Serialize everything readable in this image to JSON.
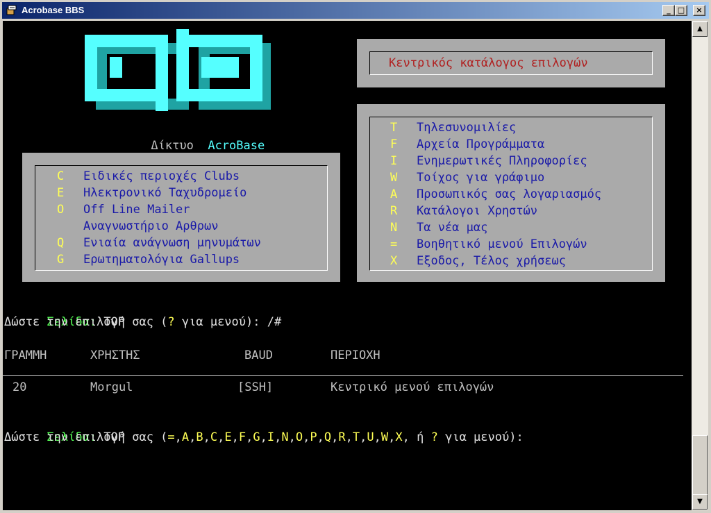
{
  "window": {
    "title": "Acrobase BBS",
    "buttons": {
      "minimize": "_",
      "maximize": "□",
      "close": "×"
    }
  },
  "logo": {
    "network_label": "Δίκτυο",
    "network_name": "AcroBase",
    "color": "#55ffff"
  },
  "main_menu_title": "Κεντρικός κατάλογος επιλογών",
  "left_menu": [
    {
      "key": "C",
      "label": "Ειδικές περιοχές Clubs"
    },
    {
      "key": "E",
      "label": "Ηλεκτρονικό Ταχυδρομείο"
    },
    {
      "key": "O",
      "label": "Off Line Mailer"
    },
    {
      "key": "",
      "label": "Αναγνωστήριο Αρθρων"
    },
    {
      "key": "Q",
      "label": "Ενιαία ανάγνωση μηνυμάτων"
    },
    {
      "key": "G",
      "label": "Ερωτηματολόγια Gallups"
    }
  ],
  "right_menu": [
    {
      "key": "T",
      "label": "Τηλεσυνομιλίες"
    },
    {
      "key": "F",
      "label": "Αρχεία Προγράμματα"
    },
    {
      "key": "I",
      "label": "Ενημερωτικές Πληροφορίες"
    },
    {
      "key": "W",
      "label": "Τοίχος για γράφιμο"
    },
    {
      "key": "A",
      "label": "Προσωπικός σας λογαριασμός"
    },
    {
      "key": "R",
      "label": "Κατάλογοι Χρηστών"
    },
    {
      "key": "N",
      "label": "Τα νέα μας"
    },
    {
      "key": "=",
      "label": "Βοηθητικό μενού Επιλογών"
    },
    {
      "key": "X",
      "label": "Εξοδος, Τέλος χρήσεως"
    }
  ],
  "prompt1": {
    "page_label": "Σελίδα:",
    "page_value": "TOP",
    "prompt_prefix": "Δώστε την επιλογή σας (",
    "prompt_key": "?",
    "prompt_suffix": " για μενού): /#"
  },
  "who_table": {
    "headers": [
      "ΓΡΑΜΜΗ",
      "ΧΡΗΣΤΗΣ",
      "BAUD",
      "ΠΕΡΙΟΧΗ"
    ],
    "rows": [
      [
        "20",
        "Morgul",
        "[SSH]",
        "Κεντρικό μενού επιλογών"
      ]
    ]
  },
  "prompt2": {
    "page_label": "Σελίδα:",
    "page_value": "TOP",
    "prompt_prefix": "Δώστε την επιλογή σας (",
    "keys": [
      "=",
      "A",
      "B",
      "C",
      "E",
      "F",
      "G",
      "I",
      "N",
      "O",
      "P",
      "Q",
      "R",
      "T",
      "U",
      "W",
      "X"
    ],
    "or_word": "ή",
    "help_key": "?",
    "prompt_suffix": " για μενού):"
  },
  "colors": {
    "terminal_bg": "#000000",
    "panel_bg": "#aaaaaa",
    "menu_text": "#1a1aa8",
    "menu_key": "#ffff55",
    "title_text": "#b02020",
    "page_label": "#55ff55"
  }
}
